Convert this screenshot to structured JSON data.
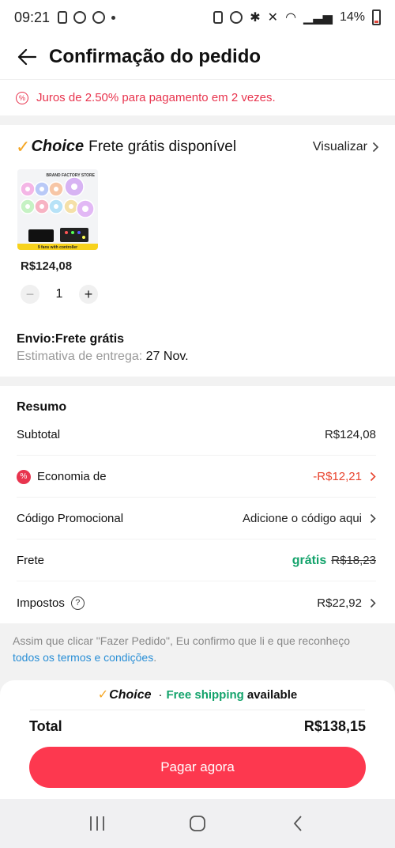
{
  "status_bar": {
    "time": "09:21",
    "battery": "14%"
  },
  "header": {
    "title": "Confirmação do pedido"
  },
  "notice": {
    "text": "Juros de 2.50% para pagamento em 2 vezes."
  },
  "shipping": {
    "choice_label": "Choice",
    "free_shipping_text": "Frete grátis disponível",
    "view_label": "Visualizar",
    "product_price": "R$124,08",
    "quantity": "1",
    "envio_label": "Envio:Frete grátis",
    "estimate_label": "Estimativa de entrega:",
    "estimate_date": "27 Nov.",
    "product_image": {
      "brand_text": "BRAND FACTORY STORE",
      "caption": "9 fans with controller"
    }
  },
  "summary": {
    "title": "Resumo",
    "subtotal_label": "Subtotal",
    "subtotal_value": "R$124,08",
    "savings_label": "Economia de",
    "savings_value": "-R$12,21",
    "promo_label": "Código Promocional",
    "promo_value": "Adicione o código aqui",
    "shipping_label": "Frete",
    "shipping_free": "grátis",
    "shipping_original": "R$18,23",
    "taxes_label": "Impostos",
    "taxes_value": "R$22,92"
  },
  "terms": {
    "text": "Assim que clicar \"Fazer Pedido\", Eu confirmo que li e que reconheço ",
    "link": "todos os termos e condições",
    "end": "."
  },
  "bottom": {
    "choice_label": "Choice",
    "separator": "·",
    "free_shipping": "Free shipping",
    "available": "available",
    "total_label": "Total",
    "total_value": "R$138,15",
    "pay_button": "Pagar agora"
  },
  "colors": {
    "accent": "#fd384f",
    "red_text": "#e8344e",
    "green": "#13a36b",
    "choice_check": "#f5a623",
    "link": "#2a8fd6"
  },
  "icons": {
    "back": "arrow-left-icon",
    "chevron": "chevron-right-icon",
    "help": "question-circle-icon",
    "discount": "percent-badge-icon",
    "nav": [
      "recents-icon",
      "home-icon",
      "back-nav-icon"
    ]
  }
}
